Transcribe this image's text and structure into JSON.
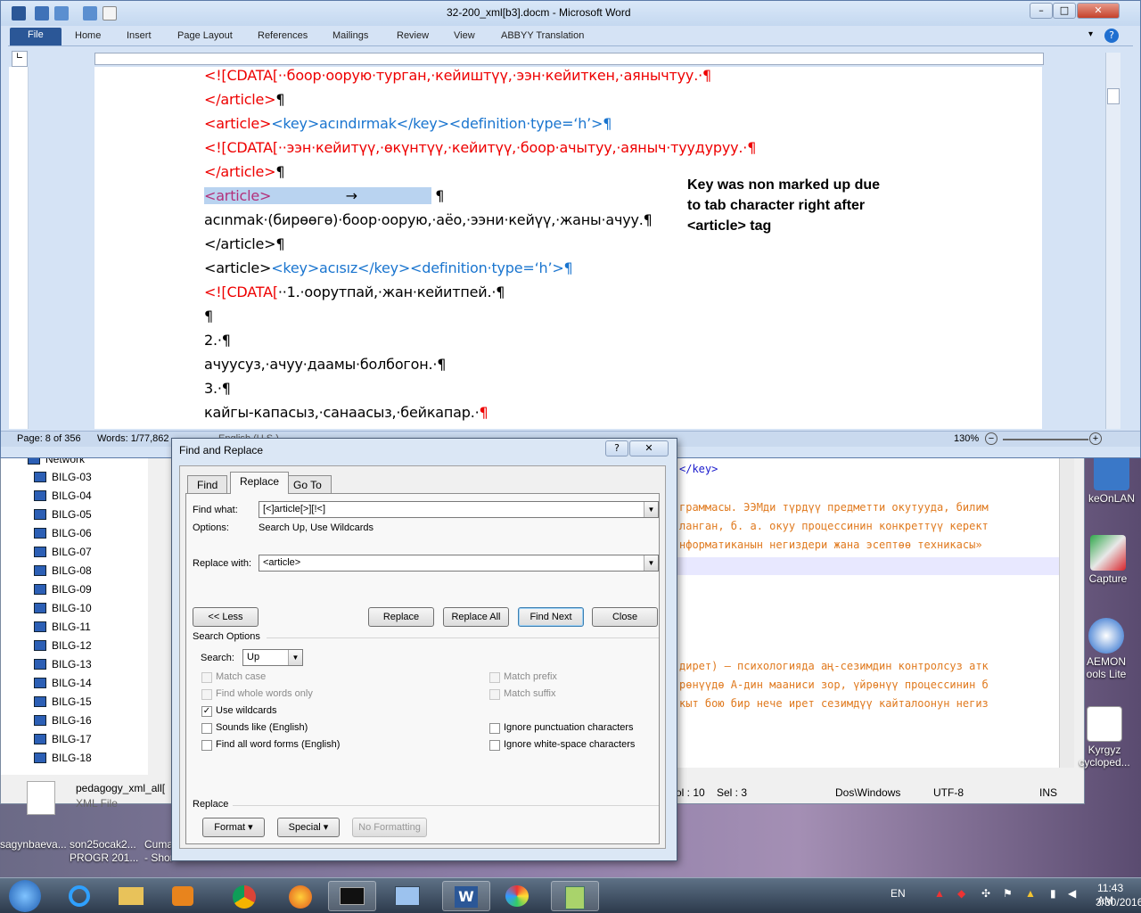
{
  "word": {
    "title": "32-200_xml[b3].docm  -  Microsoft Word",
    "tabs": [
      "File",
      "Home",
      "Insert",
      "Page Layout",
      "References",
      "Mailings",
      "Review",
      "View",
      "ABBYY Translation"
    ],
    "status": {
      "page": "Page: 8 of 356",
      "words": "Words: 1/77,862",
      "language": "English (U.S.)",
      "zoom": "130%"
    },
    "lines": [
      {
        "a": "<![CDATA[",
        "b": "··боор·оорую·турган,·кейиштүү,·ээн·кейиткен,·аянычтуу.·",
        "c": "¶"
      },
      {
        "a": "</article>",
        "b": "",
        "c": "¶"
      },
      {
        "a": "<article>",
        "b": "<key>acındırmak</key><definition·type=‘h’>",
        "c": "¶"
      },
      {
        "a": "<![CDATA[",
        "b": "··ээн·кейитүү,·өкүнтүү,·кейитүү,·боор·ачытуу,·аяныч·туудуруу.·",
        "c": "¶"
      },
      {
        "a": "</article>",
        "b": "",
        "c": "¶"
      },
      {
        "a": "<article>",
        "b": "→",
        "c": "¶"
      },
      {
        "a": "",
        "b": "acınmak·(бирөөгө)·боор·оорую,·аёо,·ээни·кейүү,·жаны·ачуу.",
        "c": "¶"
      },
      {
        "a": "",
        "b": "</article>",
        "c": "¶"
      },
      {
        "a": "<article>",
        "b": "<key>acısız</key><definition·type=‘h’>",
        "c": "¶"
      },
      {
        "a": "<![CDATA[",
        "b": "··1.·оорутпай,·жан·кейитпей.·",
        "c": "¶"
      },
      {
        "a": "",
        "b": "",
        "c": "¶"
      },
      {
        "a": "",
        "b": "2.·",
        "c": "¶"
      },
      {
        "a": "",
        "b": "ачуусуз,·ачуу·даамы·болбогон.·",
        "c": "¶"
      },
      {
        "a": "",
        "b": "3.·",
        "c": "¶"
      },
      {
        "a": "",
        "b": "кайгы-капасыз,·санаасыз,·бейкапар.·",
        "c": "¶"
      }
    ],
    "annotation": [
      "Key was non marked up due",
      "to tab character right after",
      "<article> tag"
    ]
  },
  "dialog": {
    "title": "Find and Replace",
    "tabs": [
      "Find",
      "Replace",
      "Go To"
    ],
    "find_label": "Find what:",
    "find_value": "[<]article[>][!<]",
    "options_label": "Options:",
    "options_value": "Search Up, Use Wildcards",
    "replace_label": "Replace with:",
    "replace_value": "<article>",
    "buttons": {
      "less": "<< Less",
      "replace": "Replace",
      "replace_all": "Replace All",
      "find_next": "Find Next",
      "close": "Close"
    },
    "search_options_title": "Search Options",
    "search_label": "Search:",
    "search_value": "Up",
    "checks": {
      "match_case": "Match case",
      "whole_words": "Find whole words only",
      "wildcards": "Use wildcards",
      "sounds_like": "Sounds like (English)",
      "word_forms": "Find all word forms (English)",
      "match_prefix": "Match prefix",
      "match_suffix": "Match suffix",
      "ignore_punct": "Ignore punctuation characters",
      "ignore_space": "Ignore white-space characters"
    },
    "replace_section": "Replace",
    "format_btn": "Format ▾",
    "special_btn": "Special ▾",
    "noformat_btn": "No Formatting"
  },
  "background": {
    "network": "Network",
    "nodes": [
      "BILG-03",
      "BILG-04",
      "BILG-05",
      "BILG-06",
      "BILG-07",
      "BILG-08",
      "BILG-09",
      "BILG-10",
      "BILG-11",
      "BILG-12",
      "BILG-13",
      "BILG-14",
      "BILG-15",
      "BILG-16",
      "BILG-17",
      "BILG-18"
    ],
    "file_name": "pedagogy_xml_all[",
    "file_type": "XML File",
    "editor_lines": [
      {
        "text": "</key>",
        "color": "#1a1acc"
      },
      {
        "text": "граммасы. ЭЭМди түрдүү предметти окутууда, билим",
        "color": "#e07a1f"
      },
      {
        "text": "ланган, б. а. окуу процессинин конкреттүү керект",
        "color": "#e07a1f"
      },
      {
        "text": "нформатиканын негиздери жана эсептөө техникасы»",
        "color": "#e07a1f"
      },
      {
        "text": "дирет) – психологияда аң-сезимдин контролсуз атк",
        "color": "#e07a1f"
      },
      {
        "text": "рөнүүдө А-дин мааниси зор, үйрөнүү процессинин б",
        "color": "#e07a1f"
      },
      {
        "text": "кыт бою бир нече ирет сезимдүү кайталоонун негиз",
        "color": "#e07a1f"
      }
    ],
    "status": {
      "col": "ol : 10",
      "sel": "Sel : 3",
      "eol": "Dos\\Windows",
      "enc": "UTF-8",
      "ins": "INS"
    },
    "desktop_icons": [
      "keOnLAN",
      "Capture",
      "AEMON\nools Lite",
      "Kyrgyz\ncycloped..."
    ],
    "taskbar_labels": [
      "sagynbaeva...",
      "son25ocak2...\nPROGR 201...",
      "Cumak\n- Shor"
    ]
  },
  "tray": {
    "lang": "EN",
    "time": "11:43 AM",
    "date": "3/30/2016"
  }
}
